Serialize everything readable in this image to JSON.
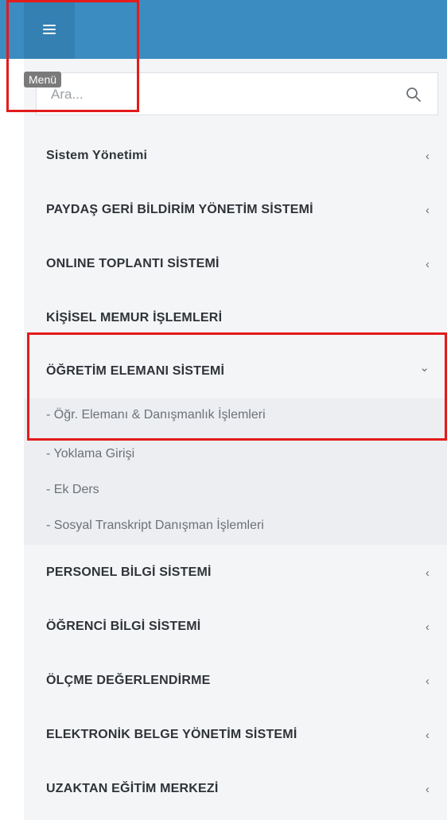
{
  "header": {
    "menu_tooltip": "Menü"
  },
  "search": {
    "placeholder": "Ara..."
  },
  "menu": {
    "items": [
      {
        "label": "Sistem Yönetimi",
        "chevron": "‹"
      },
      {
        "label": "PAYDAŞ GERİ BİLDİRİM YÖNETİM SİSTEMİ",
        "chevron": "‹"
      },
      {
        "label": "ONLINE TOPLANTI SİSTEMİ",
        "chevron": "‹"
      },
      {
        "label": "KİŞİSEL MEMUR İŞLEMLERİ",
        "chevron": ""
      },
      {
        "label": "ÖĞRETİM ELEMANI SİSTEMİ",
        "chevron": "⌄"
      },
      {
        "label": "PERSONEL BİLGİ SİSTEMİ",
        "chevron": "‹"
      },
      {
        "label": "ÖĞRENCİ BİLGİ SİSTEMİ",
        "chevron": "‹"
      },
      {
        "label": "ÖLÇME DEĞERLENDİRME",
        "chevron": "‹"
      },
      {
        "label": "ELEKTRONİK BELGE YÖNETİM SİSTEMİ",
        "chevron": "‹"
      },
      {
        "label": "UZAKTAN EĞİTİM MERKEZİ",
        "chevron": "‹"
      }
    ],
    "submenu": [
      "- Öğr. Elemanı & Danışmanlık İşlemleri",
      "- Yoklama Girişi",
      "- Ek Ders",
      "- Sosyal Transkript Danışman İşlemleri"
    ]
  },
  "colors": {
    "topbar": "#3a8cc1",
    "highlight_box": "#e41b1b",
    "sidebar_bg": "#f4f5f7"
  }
}
